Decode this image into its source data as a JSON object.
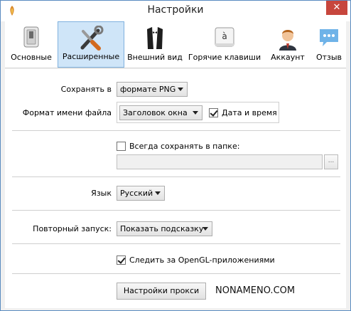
{
  "window": {
    "title": "Настройки",
    "close_glyph": "✕"
  },
  "tabs": [
    {
      "label": "Основные",
      "icon": "toggle-switch-icon"
    },
    {
      "label": "Расширенные",
      "icon": "tools-icon",
      "active": true
    },
    {
      "label": "Внешний вид",
      "icon": "tuxedo-icon"
    },
    {
      "label": "Горячие клавиши",
      "icon": "key-icon"
    },
    {
      "label": "Аккаунт",
      "icon": "user-avatar-icon"
    },
    {
      "label": "Отзыв",
      "icon": "speech-bubble-icon"
    }
  ],
  "save_format": {
    "label": "Сохранять в",
    "value": "формате PNG"
  },
  "filename_format": {
    "label": "Формат имени файла",
    "value": "Заголовок окна",
    "datetime_label": "Дата и время",
    "datetime_checked": true
  },
  "always_save": {
    "label": "Всегда сохранять в папке:",
    "checked": false,
    "path": "",
    "browse": "..."
  },
  "language": {
    "label": "Язык",
    "value": "Русский"
  },
  "relaunch": {
    "label": "Повторный запуск:",
    "value": "Показать подсказку"
  },
  "opengl": {
    "label": "Следить за OpenGL-приложениями",
    "checked": true
  },
  "proxy_button": "Настройки прокси",
  "watermark": "NONAMENO.COM"
}
